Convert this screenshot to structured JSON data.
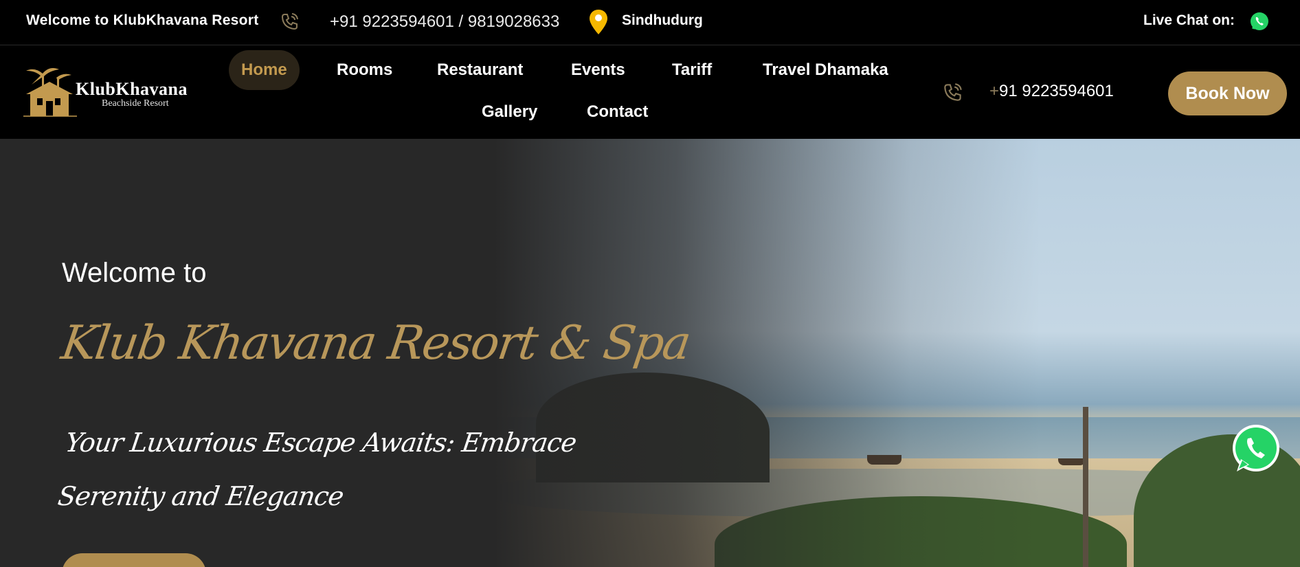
{
  "topbar": {
    "welcome": "Welcome to KlubKhavana Resort",
    "phones": "+91 9223594601 / 9819028633",
    "location": "Sindhudurg",
    "live_chat": "Live Chat on:"
  },
  "logo": {
    "name": "KlubKhavana",
    "tagline": "Beachside Resort"
  },
  "nav": {
    "items": [
      {
        "label": "Home"
      },
      {
        "label": "Rooms"
      },
      {
        "label": "Restaurant"
      },
      {
        "label": "Events"
      },
      {
        "label": "Tariff"
      },
      {
        "label": "Travel Dhamaka"
      },
      {
        "label": "Gallery"
      },
      {
        "label": "Contact"
      }
    ],
    "phone_plus": "+",
    "phone": "91 9223594601",
    "book_label": "Book Now"
  },
  "hero": {
    "welcome": "Welcome to",
    "title": "Klub Khavana Resort & Spa",
    "tagline": "Your Luxurious Escape Awaits: Embrace Serenity and Elegance"
  },
  "colors": {
    "accent": "#b08d4f",
    "title_gold": "#b8975a",
    "nav_active_bg": "#2b2418",
    "whatsapp": "#25d366"
  },
  "icons": [
    "phone-icon",
    "location-pin-icon",
    "whatsapp-icon",
    "resort-logo-icon"
  ]
}
